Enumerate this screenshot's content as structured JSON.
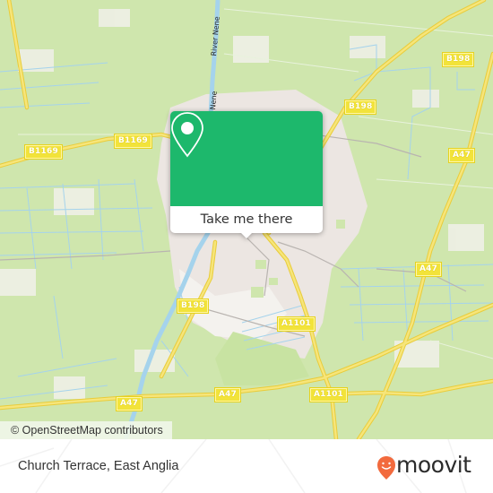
{
  "map": {
    "attribution": "© OpenStreetMap contributors",
    "river_label": "River Nene",
    "river_label_partial": "Nene",
    "colors": {
      "farmland": "#cfe6ad",
      "urban": "#ece6e2",
      "water": "#a5d3ec",
      "major_road": "#f4de5c",
      "road_label_bg": "#f2e33a"
    },
    "road_labels": [
      {
        "id": "b198-ne",
        "text": "B198"
      },
      {
        "id": "b198-e",
        "text": "B198"
      },
      {
        "id": "b1169-w",
        "text": "B1169"
      },
      {
        "id": "b1169-c",
        "text": "B1169"
      },
      {
        "id": "a47-ne",
        "text": "A47"
      },
      {
        "id": "a47-e",
        "text": "A47"
      },
      {
        "id": "b198-sw",
        "text": "B198"
      },
      {
        "id": "a1101-c",
        "text": "A1101"
      },
      {
        "id": "a47-sw",
        "text": "A47"
      },
      {
        "id": "a47-s",
        "text": "A47"
      },
      {
        "id": "a1101-s",
        "text": "A1101"
      }
    ]
  },
  "popup": {
    "icon": "map-pin-icon",
    "button_label": "Take me there",
    "accent_color": "#1db86c"
  },
  "footer": {
    "place_name": "Church Terrace, East Anglia",
    "brand": "moovit",
    "brand_color": "#f26a3d"
  }
}
